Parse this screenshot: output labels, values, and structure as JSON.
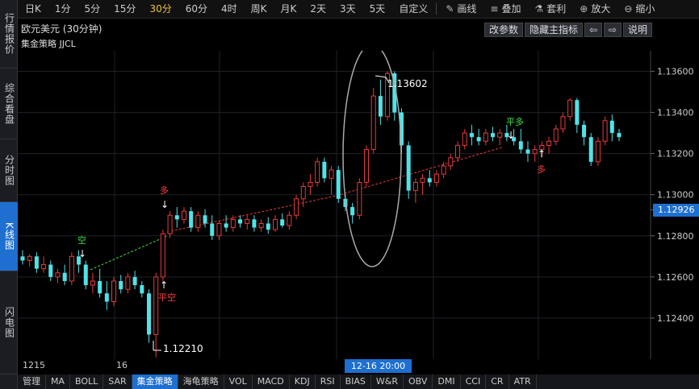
{
  "left_tabs": [
    {
      "label": "行情报价",
      "active": false
    },
    {
      "label": "综合看盘",
      "active": false
    },
    {
      "label": "分时图",
      "active": false
    },
    {
      "label": "K线图",
      "active": true
    },
    {
      "label": "闪电图",
      "active": false
    }
  ],
  "toolbar": {
    "periods": [
      "日K",
      "1分",
      "5分",
      "15分",
      "30分",
      "60分",
      "4时",
      "周K",
      "月K",
      "2天",
      "3天",
      "5天",
      "自定义"
    ],
    "active_period": "30分",
    "tools": [
      {
        "label": "画线",
        "icon": "draw-line-icon",
        "glyph": "✎"
      },
      {
        "label": "叠加",
        "icon": "stack-icon",
        "glyph": "≡"
      },
      {
        "label": "套利",
        "icon": "arbitrage-icon",
        "glyph": "⚗"
      },
      {
        "label": "放大",
        "icon": "zoom-in-icon",
        "glyph": "⊕"
      },
      {
        "label": "缩小",
        "icon": "zoom-out-icon",
        "glyph": "⊖"
      }
    ]
  },
  "title": "欧元美元 (30分钟)",
  "strategy": "集金策略 JJCL",
  "buttons": {
    "params": "改参数",
    "hide_main": "隐藏主指标",
    "prev": "⇦",
    "next": "⇨",
    "help": "说明"
  },
  "price_axis": [
    "1.13600",
    "1.13400",
    "1.13200",
    "1.13000",
    "1.12800",
    "1.12600",
    "1.12400"
  ],
  "last_price": "1.12926",
  "annotations": {
    "high": "1.13602",
    "low": "1.12210",
    "kong": "空",
    "duo1": "多",
    "pingkong": "平空",
    "pingduo": "平多",
    "duo2": "多"
  },
  "date_axis": {
    "left": "1215",
    "mid": "16",
    "crosshair": "12-16 20:00"
  },
  "indicator_tabs": [
    "管理",
    "MA",
    "BOLL",
    "SAR",
    "集金策略",
    "海龟策略",
    "VOL",
    "MACD",
    "KDJ",
    "RSI",
    "BIAS",
    "W&R",
    "OBV",
    "DMI",
    "CCI",
    "CR",
    "ATR"
  ],
  "active_indicator": "集金策略",
  "colors": {
    "up": "#e83a3a",
    "down": "#4fe3e9",
    "accent": "#1e6fd0",
    "signal_buy": "#ff4040",
    "signal_sell": "#40e040"
  },
  "chart_data": {
    "type": "candlestick",
    "ylim": [
      1.122,
      1.137
    ],
    "candles": [
      [
        1.127,
        1.1273,
        1.1266,
        1.1268
      ],
      [
        1.1268,
        1.1271,
        1.1265,
        1.127
      ],
      [
        1.127,
        1.1272,
        1.1262,
        1.1264
      ],
      [
        1.1264,
        1.127,
        1.1262,
        1.1266
      ],
      [
        1.1266,
        1.1268,
        1.1258,
        1.126
      ],
      [
        1.126,
        1.1264,
        1.1257,
        1.1262
      ],
      [
        1.1262,
        1.1266,
        1.1256,
        1.1258
      ],
      [
        1.1258,
        1.1272,
        1.1256,
        1.127
      ],
      [
        1.127,
        1.1273,
        1.1262,
        1.1266
      ],
      [
        1.1266,
        1.1268,
        1.1254,
        1.1256
      ],
      [
        1.1256,
        1.1262,
        1.1252,
        1.1258
      ],
      [
        1.1258,
        1.1264,
        1.125,
        1.1252
      ],
      [
        1.1252,
        1.1258,
        1.1244,
        1.1248
      ],
      [
        1.1248,
        1.126,
        1.1246,
        1.1258
      ],
      [
        1.1258,
        1.1261,
        1.1252,
        1.1254
      ],
      [
        1.1254,
        1.1262,
        1.1252,
        1.126
      ],
      [
        1.126,
        1.1263,
        1.1254,
        1.1256
      ],
      [
        1.1256,
        1.1258,
        1.125,
        1.1252
      ],
      [
        1.1252,
        1.1254,
        1.1228,
        1.1232
      ],
      [
        1.1232,
        1.1262,
        1.1221,
        1.126
      ],
      [
        1.126,
        1.1283,
        1.1258,
        1.1281
      ],
      [
        1.1281,
        1.1292,
        1.1279,
        1.129
      ],
      [
        1.129,
        1.1294,
        1.1284,
        1.1288
      ],
      [
        1.1288,
        1.1294,
        1.1286,
        1.1292
      ],
      [
        1.1292,
        1.1294,
        1.1282,
        1.1284
      ],
      [
        1.1284,
        1.1292,
        1.1282,
        1.129
      ],
      [
        1.129,
        1.1293,
        1.1284,
        1.1286
      ],
      [
        1.1286,
        1.129,
        1.1278,
        1.128
      ],
      [
        1.128,
        1.1287,
        1.1278,
        1.1286
      ],
      [
        1.1286,
        1.129,
        1.1282,
        1.1284
      ],
      [
        1.1284,
        1.129,
        1.1282,
        1.1288
      ],
      [
        1.1288,
        1.129,
        1.1284,
        1.1286
      ],
      [
        1.1286,
        1.129,
        1.1283,
        1.1288
      ],
      [
        1.1288,
        1.129,
        1.1282,
        1.1284
      ],
      [
        1.1284,
        1.1288,
        1.1282,
        1.1286
      ],
      [
        1.1286,
        1.1289,
        1.1281,
        1.1283
      ],
      [
        1.1283,
        1.129,
        1.1282,
        1.1288
      ],
      [
        1.1288,
        1.1291,
        1.1284,
        1.1285
      ],
      [
        1.1285,
        1.1292,
        1.1283,
        1.129
      ],
      [
        1.129,
        1.13,
        1.1288,
        1.1298
      ],
      [
        1.1298,
        1.1306,
        1.1294,
        1.1304
      ],
      [
        1.1304,
        1.131,
        1.13,
        1.1306
      ],
      [
        1.1306,
        1.1318,
        1.1304,
        1.1316
      ],
      [
        1.1316,
        1.1318,
        1.1306,
        1.1308
      ],
      [
        1.1308,
        1.1314,
        1.13,
        1.1312
      ],
      [
        1.1312,
        1.1314,
        1.1296,
        1.1298
      ],
      [
        1.1298,
        1.13,
        1.1292,
        1.1294
      ],
      [
        1.1294,
        1.1296,
        1.1286,
        1.129
      ],
      [
        1.129,
        1.1308,
        1.1288,
        1.1306
      ],
      [
        1.1306,
        1.1324,
        1.1304,
        1.1322
      ],
      [
        1.1322,
        1.1352,
        1.132,
        1.1348
      ],
      [
        1.1348,
        1.1356,
        1.1334,
        1.1338
      ],
      [
        1.1338,
        1.136,
        1.1336,
        1.1359
      ],
      [
        1.1359,
        1.136,
        1.1336,
        1.134
      ],
      [
        1.134,
        1.1342,
        1.132,
        1.1324
      ],
      [
        1.1324,
        1.1326,
        1.1298,
        1.1302
      ],
      [
        1.1302,
        1.1308,
        1.1296,
        1.1306
      ],
      [
        1.1306,
        1.131,
        1.13,
        1.1308
      ],
      [
        1.1308,
        1.1312,
        1.1304,
        1.1306
      ],
      [
        1.1306,
        1.1312,
        1.1304,
        1.131
      ],
      [
        1.131,
        1.1316,
        1.1308,
        1.1314
      ],
      [
        1.1314,
        1.132,
        1.1312,
        1.1318
      ],
      [
        1.1318,
        1.1326,
        1.1316,
        1.1324
      ],
      [
        1.1324,
        1.1332,
        1.1322,
        1.133
      ],
      [
        1.133,
        1.1334,
        1.1324,
        1.1328
      ],
      [
        1.1328,
        1.1332,
        1.1324,
        1.1326
      ],
      [
        1.1326,
        1.1332,
        1.1324,
        1.133
      ],
      [
        1.133,
        1.1333,
        1.1326,
        1.1328
      ],
      [
        1.1328,
        1.1332,
        1.1324,
        1.133
      ],
      [
        1.133,
        1.1334,
        1.1326,
        1.1328
      ],
      [
        1.1328,
        1.1332,
        1.1324,
        1.1326
      ],
      [
        1.1326,
        1.1332,
        1.132,
        1.1322
      ],
      [
        1.1322,
        1.1326,
        1.1316,
        1.132
      ],
      [
        1.132,
        1.1324,
        1.1316,
        1.1322
      ],
      [
        1.1322,
        1.1326,
        1.1318,
        1.1324
      ],
      [
        1.1324,
        1.1328,
        1.132,
        1.1326
      ],
      [
        1.1326,
        1.1334,
        1.1324,
        1.1332
      ],
      [
        1.1332,
        1.134,
        1.133,
        1.1338
      ],
      [
        1.1338,
        1.1347,
        1.1336,
        1.1346
      ],
      [
        1.1346,
        1.1347,
        1.133,
        1.1334
      ],
      [
        1.1334,
        1.1336,
        1.1324,
        1.1328
      ],
      [
        1.1328,
        1.133,
        1.1314,
        1.1316
      ],
      [
        1.1316,
        1.1328,
        1.1314,
        1.1326
      ],
      [
        1.1326,
        1.1338,
        1.1324,
        1.1336
      ],
      [
        1.1336,
        1.1339,
        1.1326,
        1.133
      ],
      [
        1.133,
        1.1332,
        1.1326,
        1.1328
      ]
    ]
  }
}
